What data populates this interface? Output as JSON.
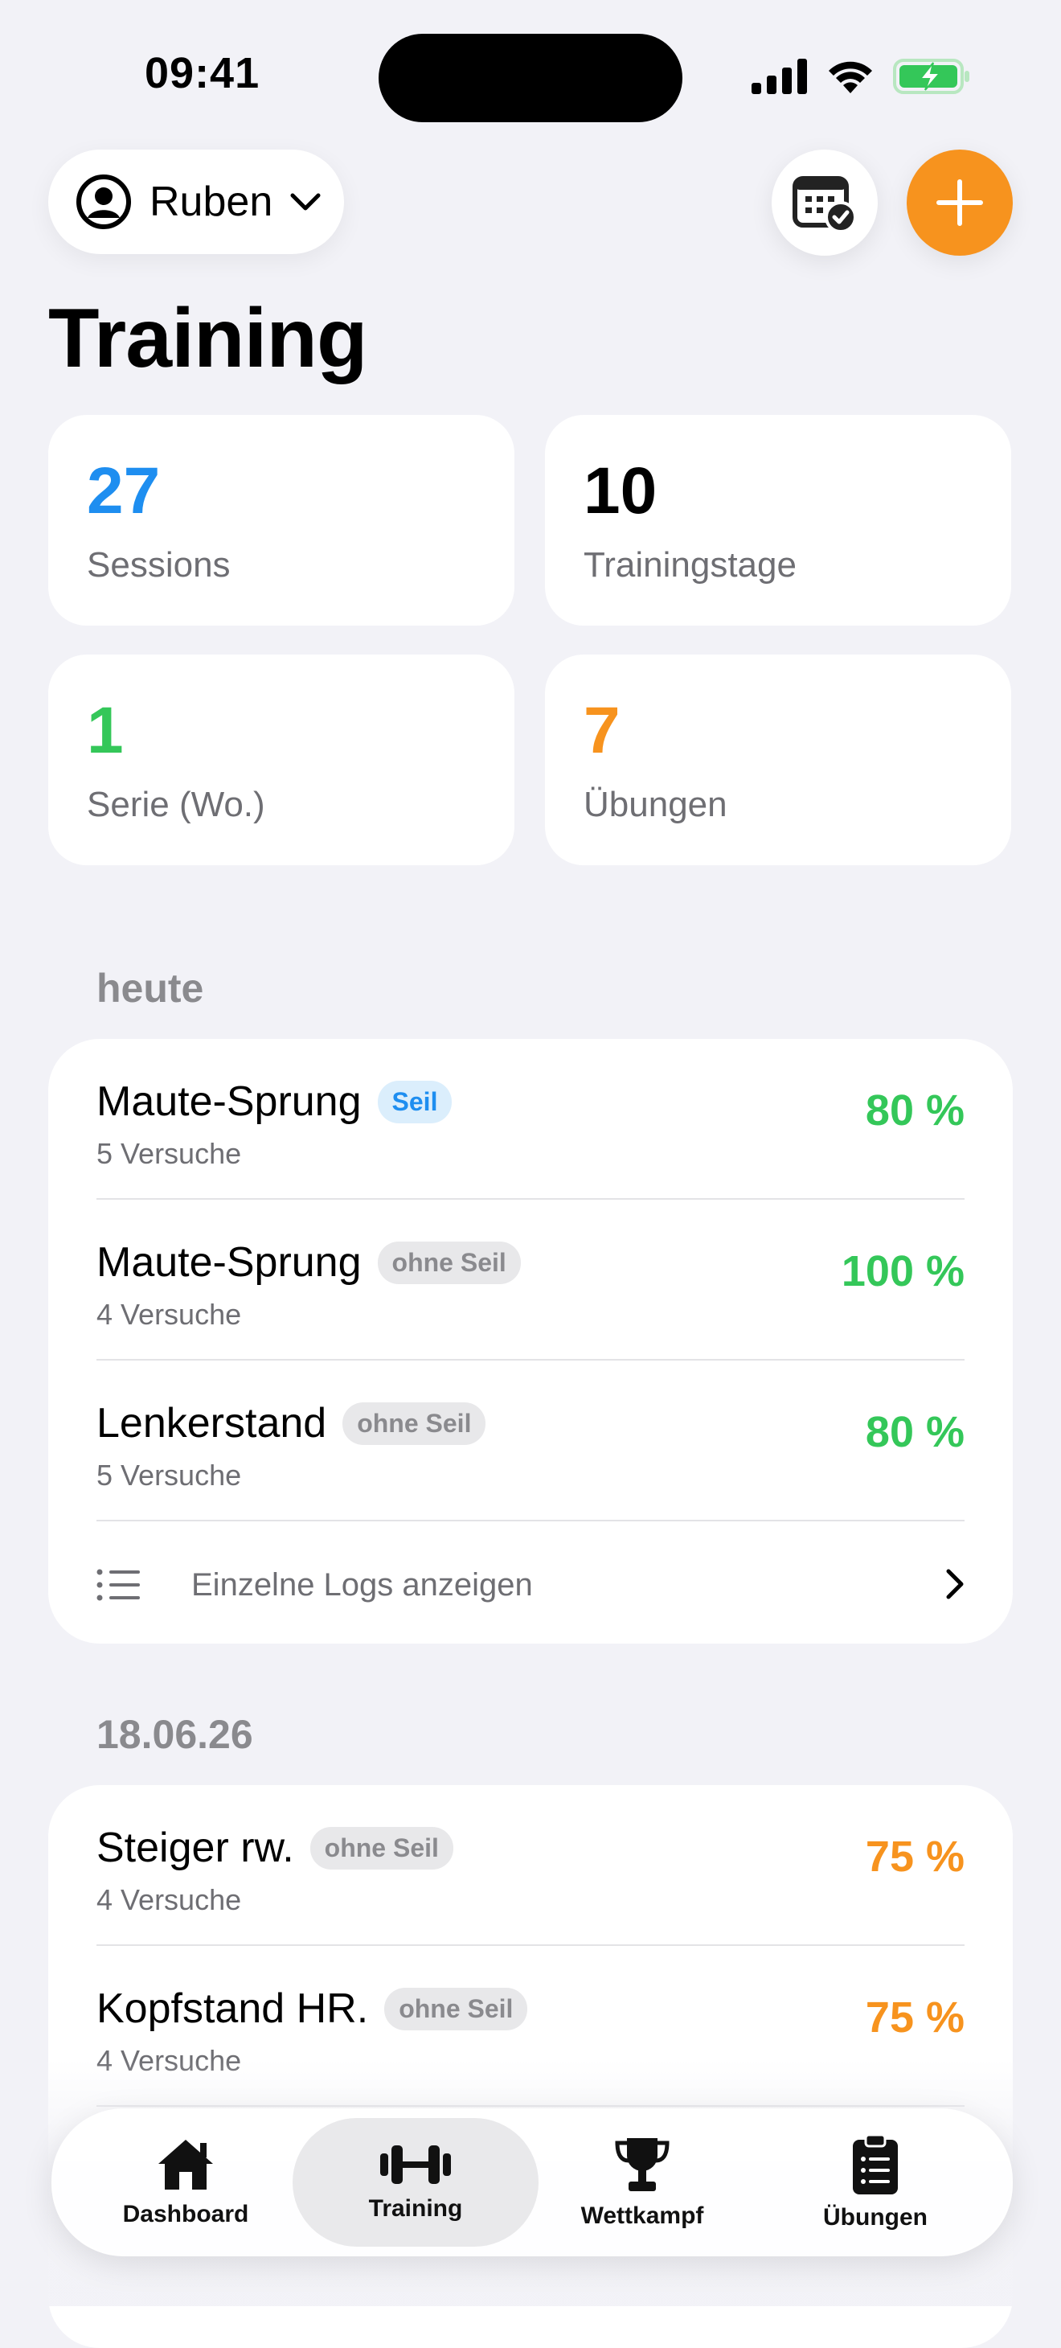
{
  "status_bar": {
    "time": "09:41"
  },
  "header": {
    "user_name": "Ruben",
    "title": "Training"
  },
  "stats": [
    {
      "value": "27",
      "label": "Sessions",
      "color": "#1e8ef0"
    },
    {
      "value": "10",
      "label": "Trainingstage",
      "color": "#000000"
    },
    {
      "value": "1",
      "label": "Serie (Wo.)",
      "color": "#34c759"
    },
    {
      "value": "7",
      "label": "Übungen",
      "color": "#f7931e"
    }
  ],
  "sections": [
    {
      "label": "heute",
      "items": [
        {
          "name": "Maute-Sprung",
          "badge": "Seil",
          "attempts": "5 Versuche",
          "percent": "80 %",
          "percent_color": "#34c759"
        },
        {
          "name": "Maute-Sprung",
          "badge": "ohne Seil",
          "attempts": "4 Versuche",
          "percent": "100 %",
          "percent_color": "#34c759"
        },
        {
          "name": "Lenkerstand",
          "badge": "ohne Seil",
          "attempts": "5 Versuche",
          "percent": "80 %",
          "percent_color": "#34c759"
        }
      ],
      "logs_link": "Einzelne Logs anzeigen"
    },
    {
      "label": "18.06.26",
      "items": [
        {
          "name": "Steiger rw.",
          "badge": "ohne Seil",
          "attempts": "4 Versuche",
          "percent": "75 %",
          "percent_color": "#f7931e"
        },
        {
          "name": "Kopfstand HR.",
          "badge": "ohne Seil",
          "attempts": "4 Versuche",
          "percent": "75 %",
          "percent_color": "#f7931e"
        }
      ]
    }
  ],
  "tabs": [
    {
      "label": "Dashboard",
      "icon": "house-icon",
      "active": false
    },
    {
      "label": "Training",
      "icon": "dumbbell-icon",
      "active": true
    },
    {
      "label": "Wettkampf",
      "icon": "trophy-icon",
      "active": false
    },
    {
      "label": "Übungen",
      "icon": "clipboard-list-icon",
      "active": false
    }
  ],
  "colors": {
    "accent": "#f7931e",
    "blue": "#1e8ef0",
    "green": "#34c759",
    "background": "#f2f2f7"
  }
}
